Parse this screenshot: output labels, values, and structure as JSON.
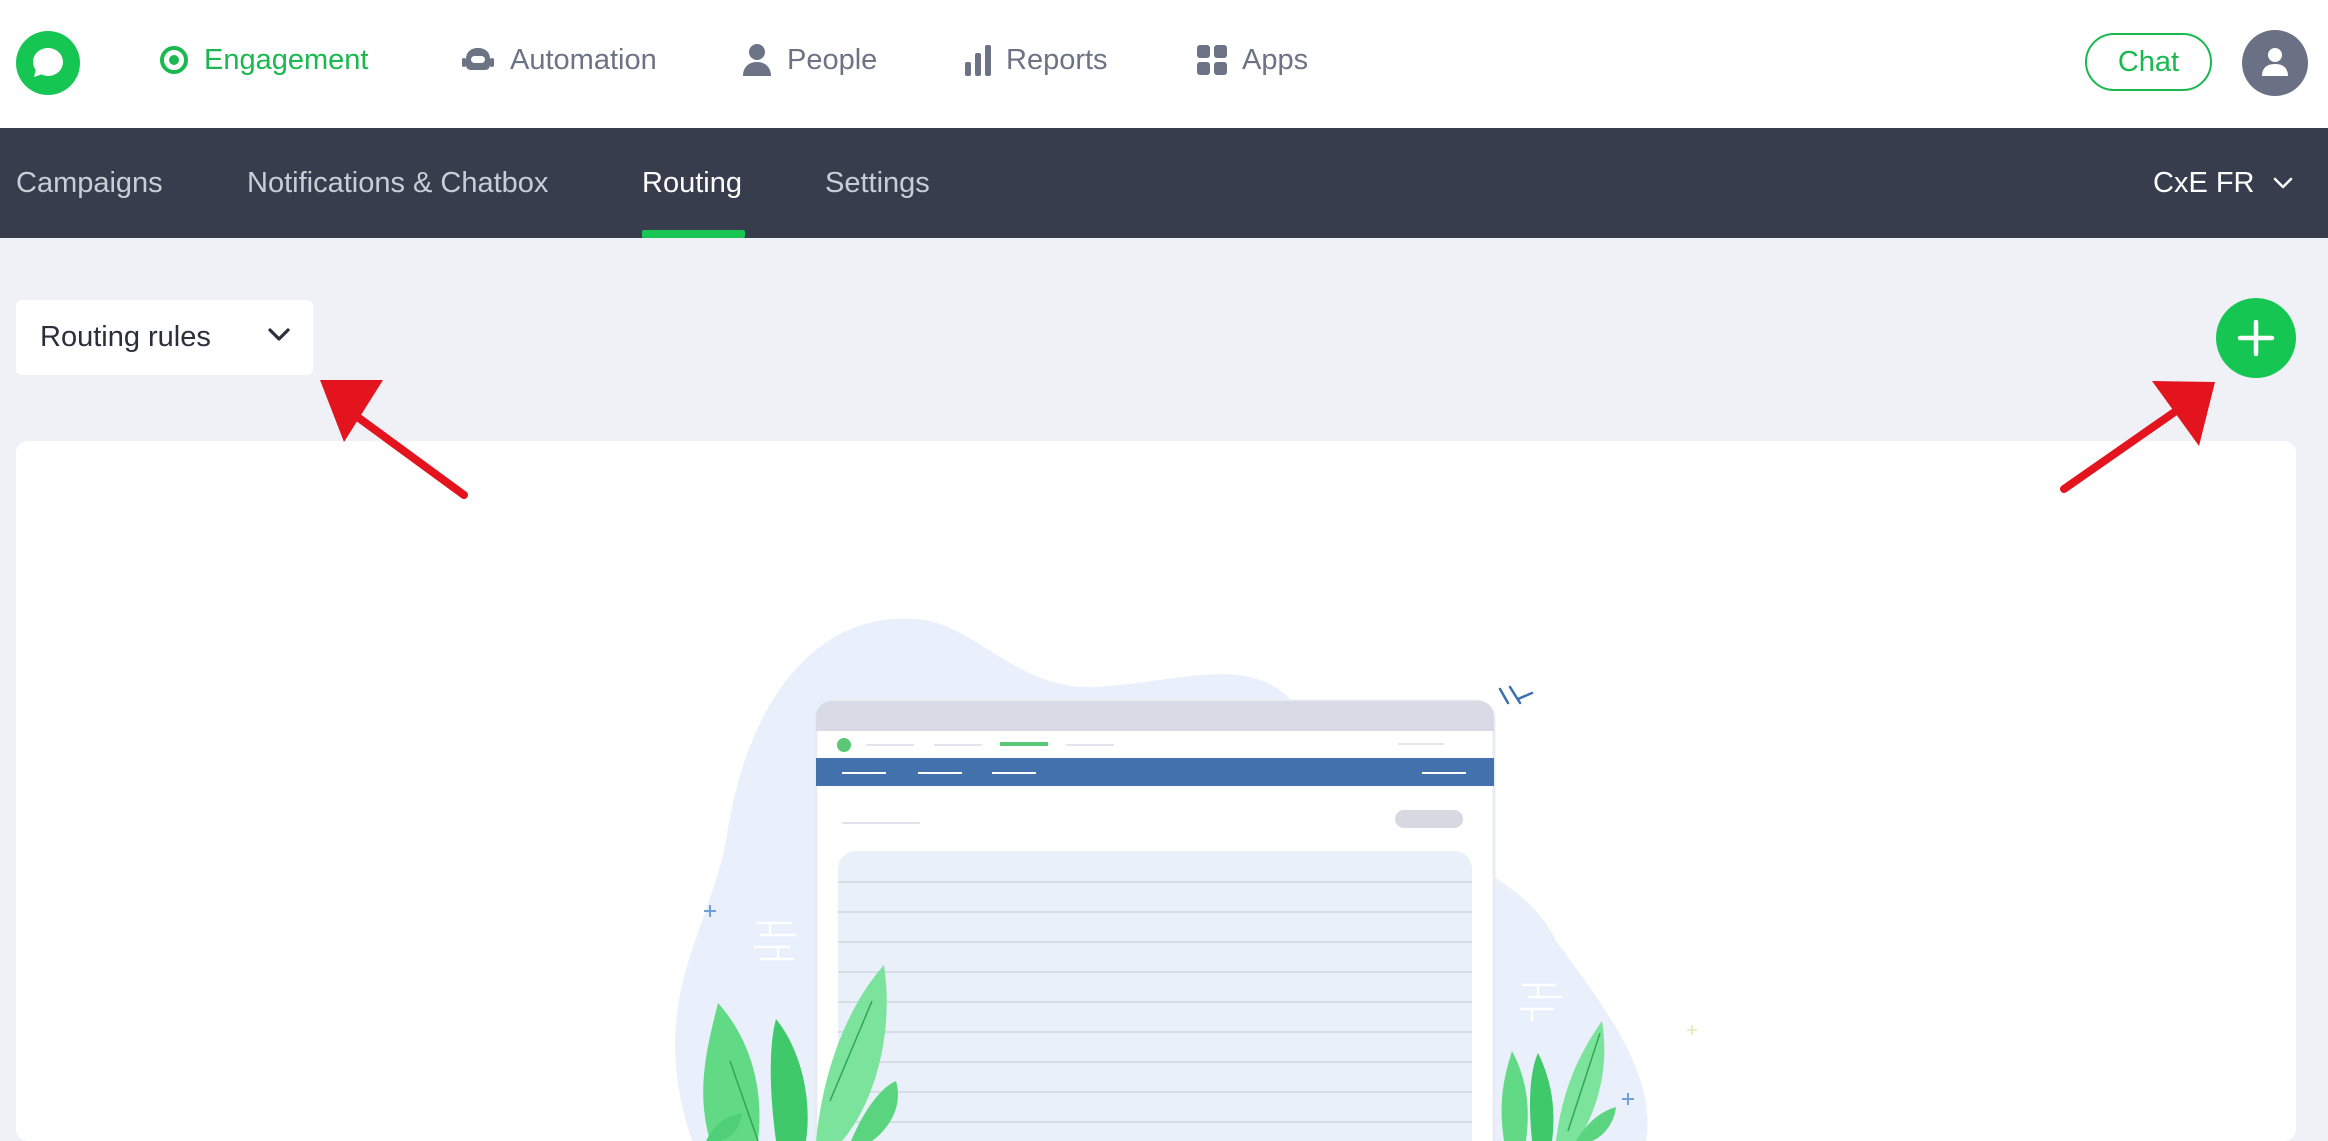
{
  "topnav": {
    "logo_icon": "chat-bubble-icon",
    "items": [
      {
        "label": "Engagement",
        "icon": "target-icon",
        "active": true
      },
      {
        "label": "Automation",
        "icon": "bot-icon",
        "active": false
      },
      {
        "label": "People",
        "icon": "person-icon",
        "active": false
      },
      {
        "label": "Reports",
        "icon": "bar-chart-icon",
        "active": false
      },
      {
        "label": "Apps",
        "icon": "grid-icon",
        "active": false
      }
    ],
    "chat_button": "Chat",
    "avatar_icon": "user-icon"
  },
  "subnav": {
    "tabs": [
      {
        "label": "Campaigns",
        "active": false
      },
      {
        "label": "Notifications & Chatbox",
        "active": false
      },
      {
        "label": "Routing",
        "active": true
      },
      {
        "label": "Settings",
        "active": false
      }
    ],
    "workspace": "CxE FR"
  },
  "toolbar": {
    "select_value": "Routing rules",
    "add_icon": "plus-icon"
  },
  "colors": {
    "brand_green": "#16c653",
    "subnav_bg": "#383d4e",
    "page_bg": "#eff1f6",
    "annotation_red": "#e3141e"
  }
}
